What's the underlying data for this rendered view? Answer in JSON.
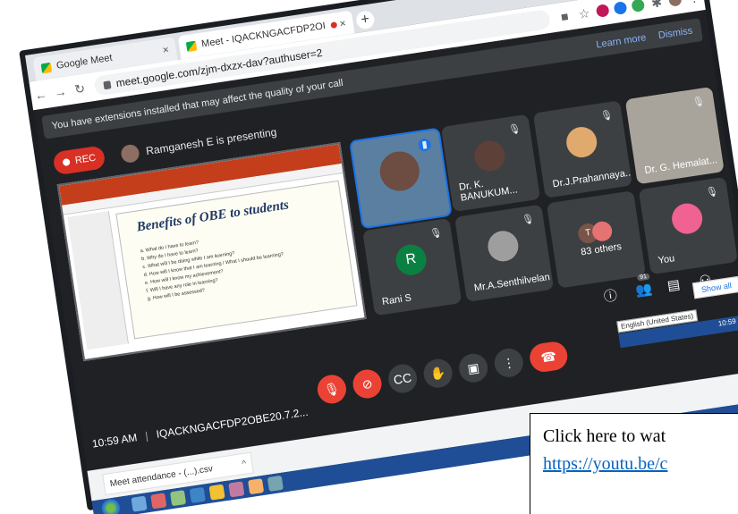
{
  "browser": {
    "tabs": [
      {
        "label": "Google Meet"
      },
      {
        "label": "Meet - IQACKNGACFDP2OI"
      }
    ],
    "url": "meet.google.com/zjm-dxzx-dav?authuser=2"
  },
  "meet": {
    "banner": {
      "text": "You have extensions installed that may affect the quality of your call",
      "learn_more": "Learn more",
      "dismiss": "Dismiss"
    },
    "rec_label": "REC",
    "presenting_text": "Ramganesh E is presenting",
    "slide": {
      "title": "Benefits of OBE to students",
      "lines": [
        "a. What do I have to learn?",
        "b. Why do I have to learn?",
        "c. What will I be doing while I am learning?",
        "d. How will I know that I am learning / What I should be learning?",
        "e. How will I know my achievement?",
        "f. Will I have any role in learning?",
        "g. How will I be assessed?"
      ]
    },
    "tiles": [
      {
        "name": "",
        "letter": ""
      },
      {
        "name": "Dr. K. BANUKUM...",
        "letter": ""
      },
      {
        "name": "Dr.J.Prahannaya...",
        "letter": ""
      },
      {
        "name": "Dr. G. Hemalat...",
        "letter": ""
      },
      {
        "name": "Rani S",
        "letter": "R"
      },
      {
        "name": "Mr.A.Senthilvelan",
        "letter": ""
      },
      {
        "name": "83 others",
        "letter": "T"
      },
      {
        "name": "You",
        "letter": ""
      }
    ],
    "people_count": "91",
    "meeting_time": "10:59 AM",
    "meeting_code": "IQACKNGACFDP2OBE20.7.2...",
    "show_all": "Show all",
    "language": "English (United States)",
    "clock": "10:59 AM"
  },
  "downloads": {
    "item": "Meet attendance - (...).csv"
  },
  "caption": {
    "text": "Click here to wat",
    "link": "https://youtu.be/c"
  },
  "colors": {
    "meet_bg": "#202124",
    "rec_red": "#d93025",
    "link_blue": "#0563c1"
  }
}
